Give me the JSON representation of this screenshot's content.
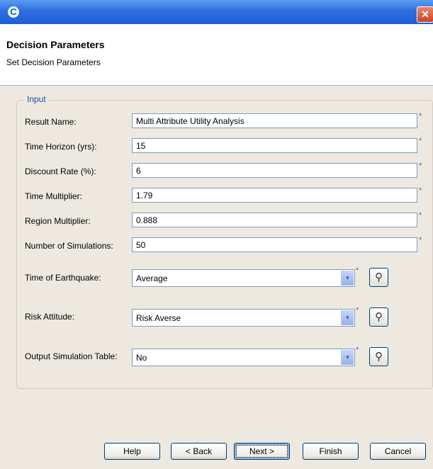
{
  "window": {
    "close_glyph": "✕",
    "app_icon_glyph": "C"
  },
  "header": {
    "title": "Decision Parameters",
    "subtitle": "Set Decision Parameters"
  },
  "group": {
    "legend": "Input"
  },
  "required_mark": "*",
  "lookup_glyph": "⚲",
  "combo_arrow_glyph": "▼",
  "fields": {
    "result_name": {
      "label": "Result Name:",
      "value": "Multi Attribute Utility Analysis"
    },
    "time_horizon": {
      "label": "Time Horizon (yrs):",
      "value": "15"
    },
    "discount_rate": {
      "label": "Discount Rate (%):",
      "value": "6"
    },
    "time_multiplier": {
      "label": "Time Multiplier:",
      "value": "1.79"
    },
    "region_multiplier": {
      "label": "Region Multiplier:",
      "value": "0.888"
    },
    "num_simulations": {
      "label": "Number of Simulations:",
      "value": "50"
    }
  },
  "combos": {
    "time_of_earthquake": {
      "label": "Time of Earthquake:",
      "value": "Average"
    },
    "risk_attitude": {
      "label": "Risk Attitude:",
      "value": "Risk Averse"
    },
    "output_simulation_table": {
      "label": "Output Simulation Table:",
      "value": "No"
    }
  },
  "buttons": {
    "help": "Help",
    "back": "< Back",
    "next": "Next >",
    "finish": "Finish",
    "cancel": "Cancel"
  }
}
